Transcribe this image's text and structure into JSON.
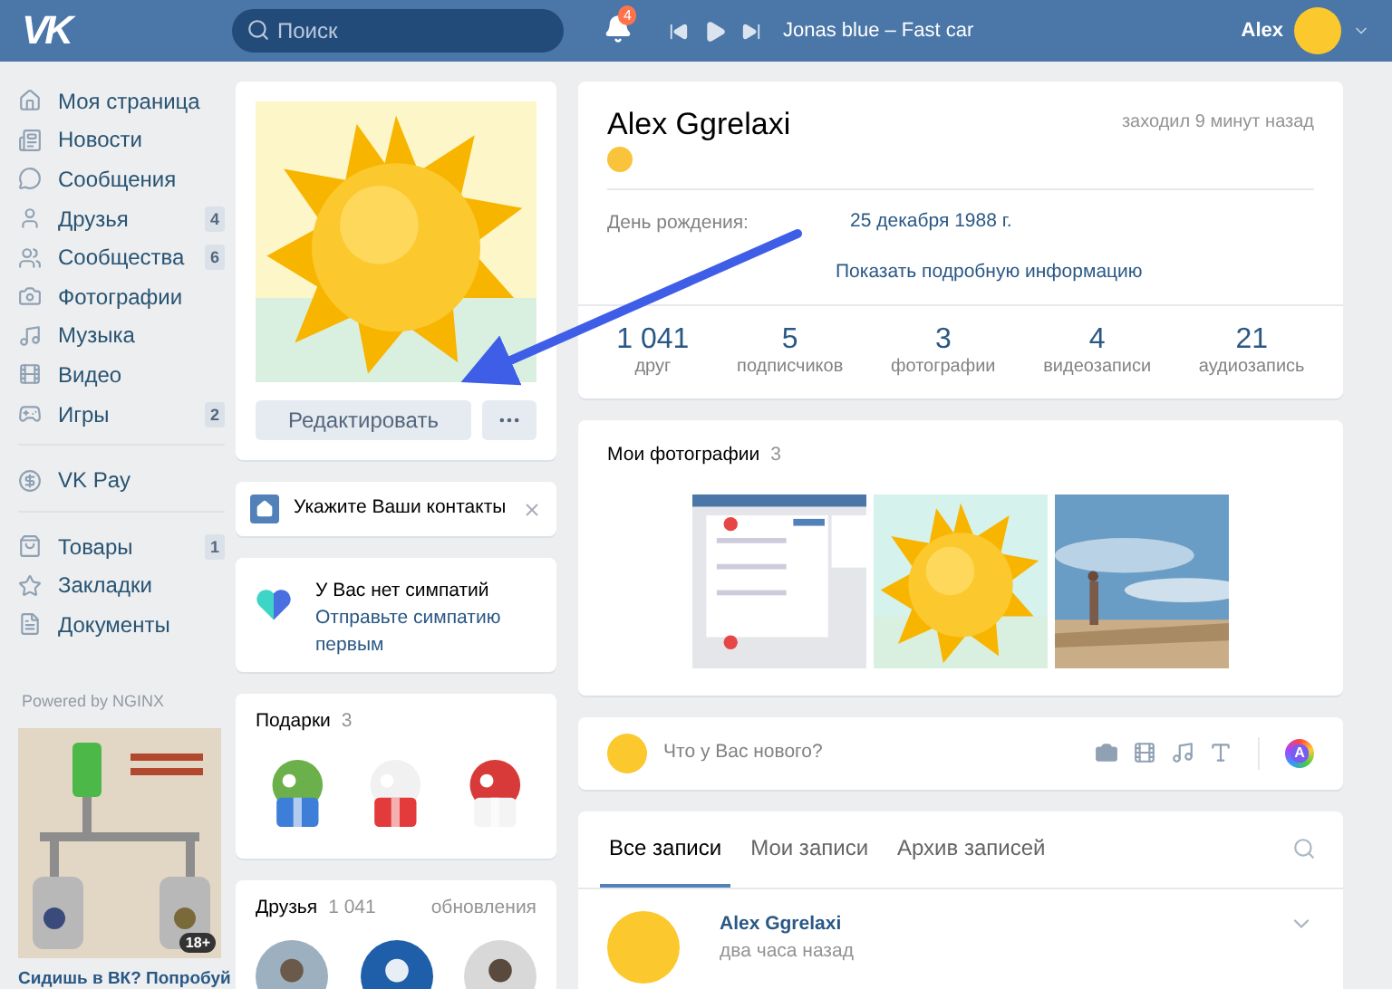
{
  "header": {
    "logo": "VK",
    "search": {
      "placeholder": "Поиск"
    },
    "notifications": "4",
    "track": "Jonas blue – Fast car",
    "user": "Alex"
  },
  "sidebar": {
    "groups": [
      {
        "items": [
          {
            "label": "Моя страница"
          },
          {
            "label": "Новости"
          },
          {
            "label": "Сообщения"
          },
          {
            "label": "Друзья",
            "count": "4"
          },
          {
            "label": "Сообщества",
            "count": "6"
          },
          {
            "label": "Фотографии"
          },
          {
            "label": "Музыка"
          },
          {
            "label": "Видео"
          },
          {
            "label": "Игры",
            "count": "2"
          }
        ]
      },
      {
        "items": [
          {
            "label": "VK Pay"
          }
        ]
      },
      {
        "items": [
          {
            "label": "Товары",
            "count": "1"
          },
          {
            "label": "Закладки"
          },
          {
            "label": "Документы"
          }
        ]
      }
    ],
    "footer": "Powered by NGINX",
    "ad": {
      "badge": "18+",
      "caption": "Сидишь в ВК? Попробуй"
    }
  },
  "avatar_card": {
    "edit_button": "Редактировать"
  },
  "contacts": {
    "text": "Укажите Ваши контакты"
  },
  "sympathy": {
    "title": "У Вас нет симпатий",
    "text": "Отправьте симпатию первым"
  },
  "gifts": {
    "title": "Подарки",
    "count": "3"
  },
  "friends": {
    "title": "Друзья",
    "count": "1 041",
    "link": "обновления"
  },
  "profile": {
    "name": "Alex Ggrelaxi",
    "status": "заходил 9 минут назад",
    "info": [
      {
        "label": "День рождения:",
        "value": "25 декабря 1988 г."
      }
    ],
    "more_link": "Показать подробную информацию",
    "counters": [
      {
        "value": "1 041",
        "label": "друг"
      },
      {
        "value": "5",
        "label": "подписчиков"
      },
      {
        "value": "3",
        "label": "фотографии"
      },
      {
        "value": "4",
        "label": "видеозаписи"
      },
      {
        "value": "21",
        "label": "аудиозапись"
      }
    ]
  },
  "photos": {
    "title": "Мои фотографии",
    "count": "3"
  },
  "post_box": {
    "placeholder": "Что у Вас нового?",
    "style_button": "A"
  },
  "wall": {
    "tabs": [
      {
        "label": "Все записи",
        "selected": true
      },
      {
        "label": "Мои записи",
        "selected": false
      },
      {
        "label": "Архив записей",
        "selected": false
      }
    ],
    "post": {
      "author": "Alex Ggrelaxi",
      "time": "два часа назад"
    }
  }
}
